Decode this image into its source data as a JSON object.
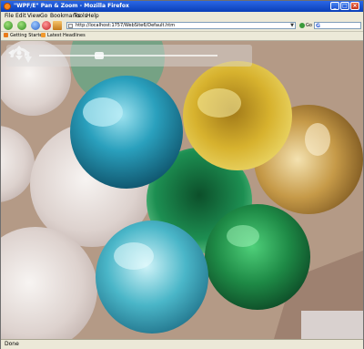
{
  "window": {
    "title": "\"WPF/E\" Pan & Zoom - Mozilla Firefox"
  },
  "menu": [
    "File",
    "Edit",
    "View",
    "Go",
    "Bookmarks",
    "Tools",
    "Help"
  ],
  "navigation": {
    "url": "http://localhost:1757/WebSite6/Default.htm",
    "go_label": "Go",
    "search_placeholder": ""
  },
  "bookmarks": [
    {
      "label": "Getting Started",
      "icon": "firefox-icon"
    },
    {
      "label": "Latest Headlines",
      "icon": "rss-feed-icon"
    }
  ],
  "page": {
    "toolbar": {
      "pan_icon": "pan-arrows-icon",
      "zoom_slider_value": 0.33,
      "reset_icon": "rotate-reset-icon"
    }
  },
  "status": {
    "text": "Done"
  },
  "colors": {
    "titlebar": "#0a3fb8",
    "chrome": "#ece9d8",
    "background": "#b59b88",
    "teal_sphere": "#1f8fa8",
    "gold_sphere": "#d4b12a",
    "green_sphere": "#1c8a4e",
    "cyan_sphere": "#4ab6c8",
    "bronze_sphere": "#b88838"
  }
}
